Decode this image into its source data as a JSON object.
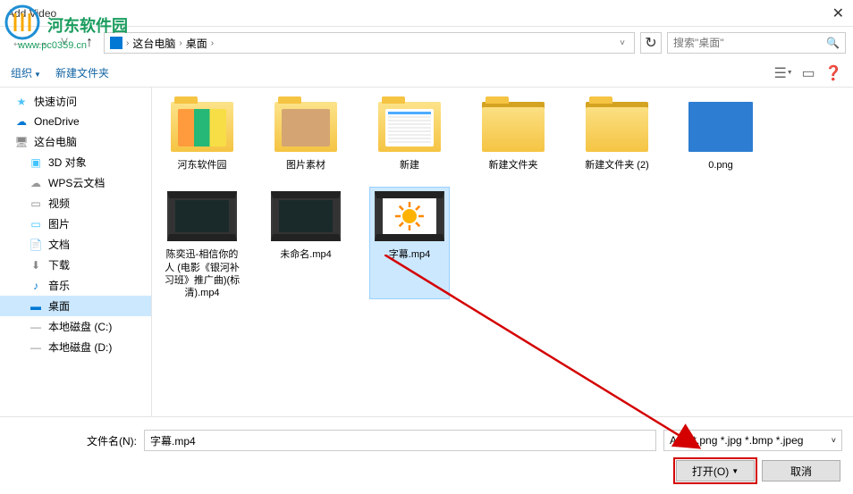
{
  "titlebar": {
    "title": "Add Video"
  },
  "watermark": {
    "name": "河东软件园",
    "url": "www.pc0359.cn"
  },
  "nav": {
    "breadcrumb": {
      "part1": "这台电脑",
      "part2": "桌面"
    },
    "search_placeholder": "搜索\"桌面\""
  },
  "toolbar": {
    "organize": "组织",
    "new_folder": "新建文件夹"
  },
  "sidebar": {
    "items": [
      {
        "label": "快速访问",
        "icon": "star"
      },
      {
        "label": "OneDrive",
        "icon": "cloud"
      },
      {
        "label": "这台电脑",
        "icon": "pc"
      },
      {
        "label": "3D 对象",
        "icon": "3d",
        "indent": true
      },
      {
        "label": "WPS云文档",
        "icon": "wps",
        "indent": true
      },
      {
        "label": "视频",
        "icon": "video",
        "indent": true
      },
      {
        "label": "图片",
        "icon": "pic",
        "indent": true
      },
      {
        "label": "文档",
        "icon": "doc",
        "indent": true
      },
      {
        "label": "下载",
        "icon": "dl",
        "indent": true
      },
      {
        "label": "音乐",
        "icon": "music",
        "indent": true
      },
      {
        "label": "桌面",
        "icon": "desktop",
        "indent": true,
        "selected": true
      },
      {
        "label": "本地磁盘 (C:)",
        "icon": "disk",
        "indent": true
      },
      {
        "label": "本地磁盘 (D:)",
        "icon": "disk",
        "indent": true
      }
    ]
  },
  "files": {
    "row1": [
      {
        "name": "河东软件园",
        "type": "folder-thumb1"
      },
      {
        "name": "图片素材",
        "type": "folder-thumb2"
      },
      {
        "name": "新建",
        "type": "folder-thumb3"
      },
      {
        "name": "新建文件夹",
        "type": "folder-empty"
      },
      {
        "name": "新建文件夹 (2)",
        "type": "folder-empty"
      },
      {
        "name": "0.png",
        "type": "img-blue"
      },
      {
        "name": "陈奕迅-相信你的人 (电影《银河补习班》推广曲)(标清).mp4",
        "type": "video-dark"
      }
    ],
    "row2": [
      {
        "name": "未命名.mp4",
        "type": "video-dark"
      },
      {
        "name": "字幕.mp4",
        "type": "video-sun",
        "selected": true
      }
    ]
  },
  "bottom": {
    "filename_label": "文件名(N):",
    "filename_value": "字幕.mp4",
    "filter": "ALL(*.png *.jpg *.bmp *.jpeg",
    "open_btn": "打开(O)",
    "cancel_btn": "取消"
  }
}
